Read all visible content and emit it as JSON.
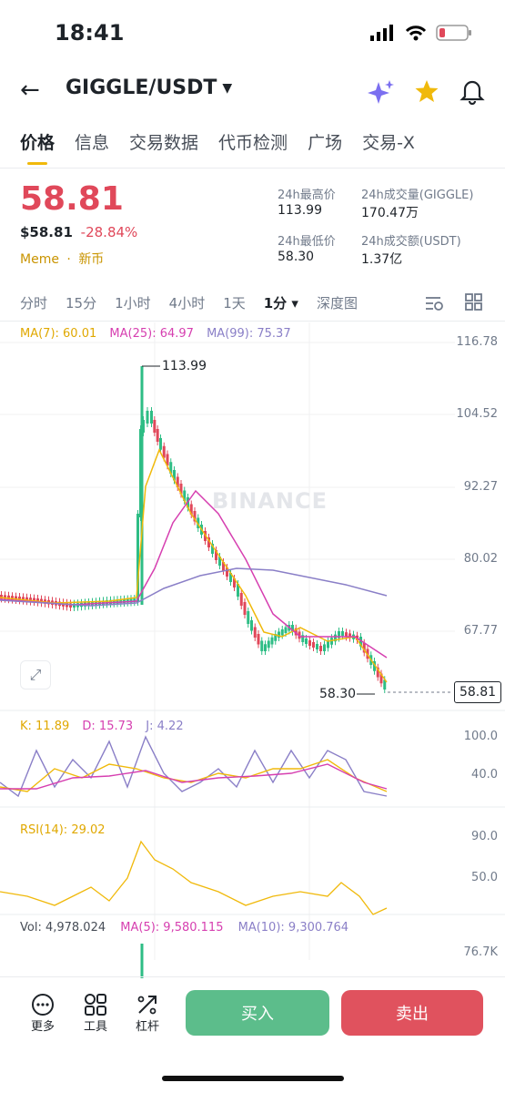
{
  "status": {
    "time": "18:41"
  },
  "header": {
    "pair": "GIGGLE/USDT"
  },
  "tabs": [
    "价格",
    "信息",
    "交易数据",
    "代币检测",
    "广场",
    "交易-X"
  ],
  "price": {
    "last": "58.81",
    "usd": "$58.81",
    "change": "-28.84%",
    "tag1": "Meme",
    "tag2": "新币",
    "high_label": "24h最高价",
    "high": "113.99",
    "low_label": "24h最低价",
    "low": "58.30",
    "vol_label": "24h成交量(GIGGLE)",
    "vol": "170.47万",
    "amt_label": "24h成交额(USDT)",
    "amt": "1.37亿"
  },
  "timeframes": [
    "分时",
    "15分",
    "1小时",
    "4小时",
    "1天",
    "1分",
    "深度图"
  ],
  "active_timeframe": "1分",
  "colors": {
    "up": "#2ebd85",
    "down": "#e0485a",
    "ma7": "#f0b90b",
    "ma25": "#d63fb0",
    "ma99": "#8a7fc7",
    "accent": "#f0b90b"
  },
  "chart_data": {
    "type": "candlestick",
    "ma_legend": {
      "ma7": "MA(7): 60.01",
      "ma25": "MA(25): 64.97",
      "ma99": "MA(99): 75.37"
    },
    "y_ticks": [
      "116.78",
      "104.52",
      "92.27",
      "80.02",
      "67.77"
    ],
    "y_range": [
      55.5,
      116.78
    ],
    "high_marker": "113.99",
    "low_marker": "58.30",
    "last_price": "58.81",
    "kdj": {
      "k": "K: 11.89",
      "d": "D: 15.73",
      "j": "J: 4.22",
      "ticks": [
        "100.0",
        "40.0"
      ]
    },
    "rsi": {
      "label": "RSI(14): 29.02",
      "ticks": [
        "90.0",
        "50.0"
      ]
    },
    "volume": {
      "vol": "Vol: 4,978.024",
      "ma5": "MA(5): 9,580.115",
      "ma10": "MA(10): 9,300.764",
      "tick": "76.7K"
    }
  },
  "watermark": "BINANCE",
  "bottom": {
    "more": "更多",
    "tools": "工具",
    "leverage": "杠杆",
    "buy": "买入",
    "sell": "卖出"
  }
}
